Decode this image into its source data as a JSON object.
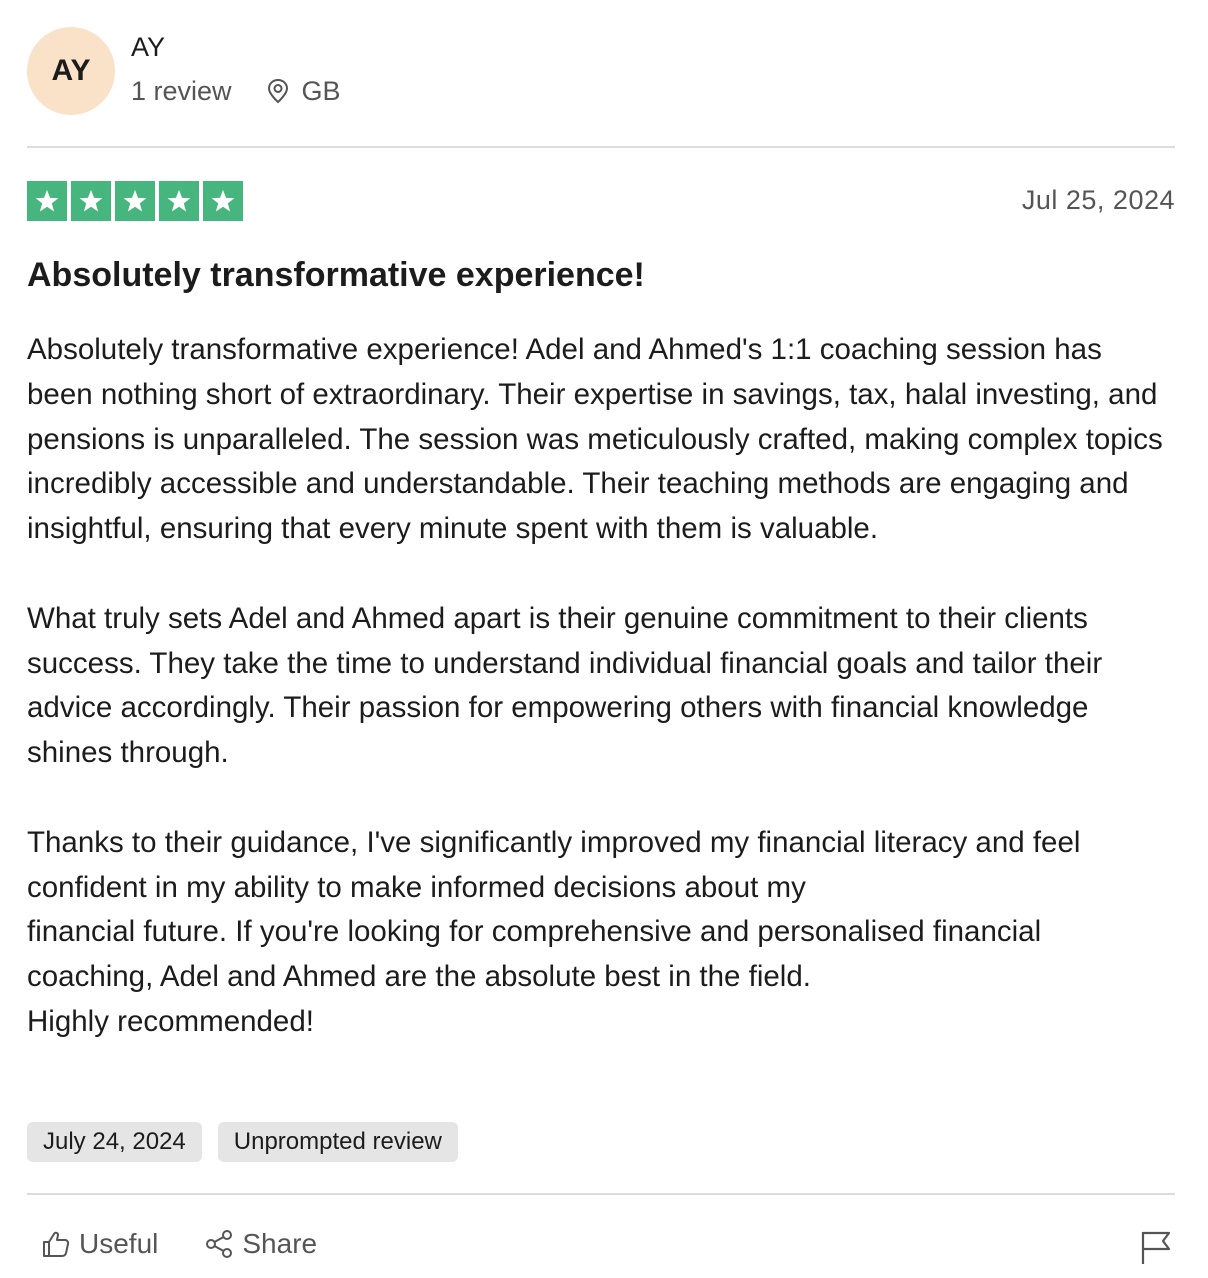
{
  "reviewer": {
    "initials": "AY",
    "name": "AY",
    "review_count": "1 review",
    "location": "GB",
    "avatar_color": "#f9e2c8"
  },
  "review": {
    "rating": 5,
    "max_rating": 5,
    "star_color": "#47b67e",
    "date": "Jul 25, 2024",
    "title": "Absolutely transformative experience!",
    "paragraphs": [
      "Absolutely transformative experience! Adel and Ahmed's 1:1 coaching session has been nothing short of extraordinary. Their expertise in savings, tax, halal investing, and pensions is unparalleled. The session was meticulously crafted, making complex topics incredibly accessible and understandable. Their teaching methods are engaging and insightful, ensuring that every minute spent with them is valuable.",
      "What truly sets Adel and Ahmed apart is their genuine commitment to their clients success. They take the time to understand individual financial goals and tailor their advice accordingly. Their passion for empowering others with financial knowledge shines through.",
      "Thanks to their guidance, I've significantly improved my financial literacy and feel confident in my ability to make informed decisions about my\nfinancial future. If you're looking for comprehensive and personalised financial coaching, Adel and Ahmed are the absolute best in the field.\nHighly recommended!"
    ],
    "tags": {
      "experience_date": "July 24, 2024",
      "review_type": "Unprompted review"
    }
  },
  "actions": {
    "useful_label": "Useful",
    "share_label": "Share",
    "useful_icon": "thumbs-up-icon",
    "share_icon": "share-icon",
    "report_icon": "flag-icon"
  }
}
